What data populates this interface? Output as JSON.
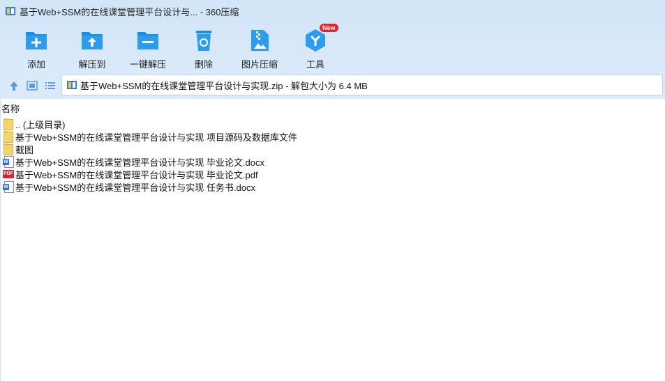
{
  "window": {
    "title": "基于Web+SSM的在线课堂管理平台设计与... - 360压缩"
  },
  "toolbar": {
    "add": "添加",
    "extract_to": "解压到",
    "one_click_extract": "一键解压",
    "delete": "删除",
    "image_compress": "图片压缩",
    "tools": "工具",
    "tools_badge": "New"
  },
  "address": {
    "path": "基于Web+SSM的在线课堂管理平台设计与实现.zip - 解包大小为 6.4 MB"
  },
  "list": {
    "header_name": "名称",
    "items": [
      {
        "name": ".. (上级目录)",
        "icon": "folder-icon"
      },
      {
        "name": "基于Web+SSM的在线课堂管理平台设计与实现 项目源码及数据库文件",
        "icon": "folder-icon"
      },
      {
        "name": "截图",
        "icon": "folder-icon"
      },
      {
        "name": "基于Web+SSM的在线课堂管理平台设计与实现 毕业论文.docx",
        "icon": "word-doc-icon"
      },
      {
        "name": "基于Web+SSM的在线课堂管理平台设计与实现 毕业论文.pdf",
        "icon": "pdf-icon"
      },
      {
        "name": "基于Web+SSM的在线课堂管理平台设计与实现 任务书.docx",
        "icon": "word-doc-icon"
      }
    ]
  },
  "colors": {
    "accent": "#1a8fe6",
    "toolbar_bg": "#d3e6f8",
    "badge": "#e8232d"
  }
}
